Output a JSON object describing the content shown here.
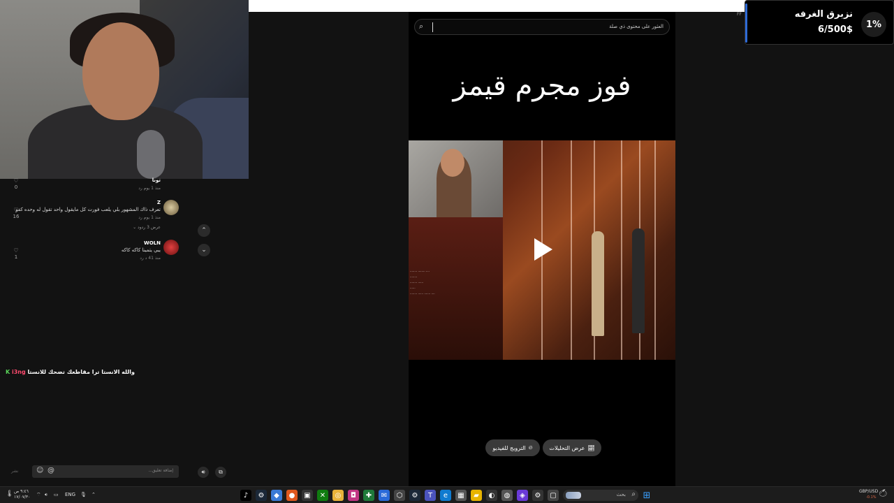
{
  "search": {
    "placeholder": "العثور على محتوى ذي صلة"
  },
  "video": {
    "title": "فوز مجرم قيمز"
  },
  "video_overlay_lines": [
    "........ ........ ....",
    "........",
    "........ ......",
    "......",
    "........ ...... ....... ...."
  ],
  "buttons": {
    "analytics": "عرض التحليلات",
    "promote": "الترويج للفيديو"
  },
  "goal": {
    "title": "نزبرق الغرفه",
    "amount": "6/500$",
    "percent": "1%",
    "side_label": "FF"
  },
  "comments": [
    {
      "name": "تونا",
      "text": "",
      "meta": "منذ 1 يوم    رد",
      "likes": "0"
    },
    {
      "name": "Z",
      "text": "تعرف ذاك المشهور بلي يلعب فورت كل مايقول واحد تقول له وحده كفو",
      "meta": "منذ 1 يوم    رد",
      "likes": "16",
      "view_replies": "عرض 3 ردود ⌄"
    },
    {
      "name": "WOLN",
      "text": "يبي يتمينا كاكه كاكه",
      "meta": "منذ 41 د    رد",
      "likes": "1"
    }
  ],
  "chat": {
    "badge": "K",
    "username": "i3ng",
    "message": "والله الانستا ترا مقاطعك تضحك للانستا"
  },
  "comment_input": {
    "placeholder": "إضافة تعليق...",
    "post_label": "نشر"
  },
  "taskbar": {
    "search_placeholder": "بحث",
    "lang": "ENG",
    "currency": "GBP/USD",
    "currency_change": "-0.1%",
    "time": "٩:٤٦ ص",
    "date": "١٧/٠٧/٣٠"
  }
}
